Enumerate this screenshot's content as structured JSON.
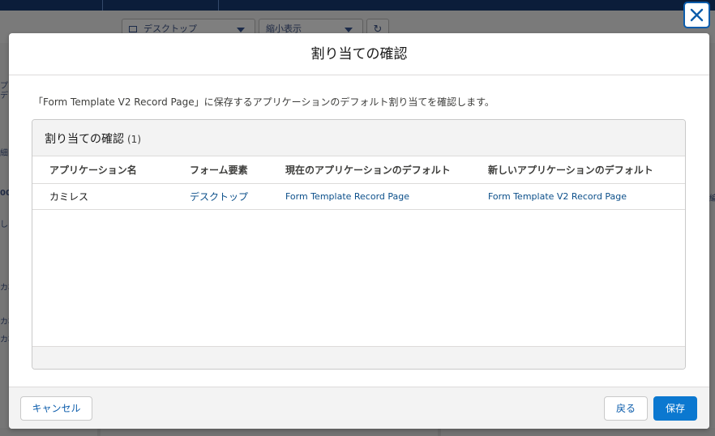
{
  "background": {
    "device_select": "デスクトップ",
    "view_select": "縮小表示",
    "refresh_icon": "refresh-icon",
    "left_fragments": [
      "プ",
      "デ",
      "細",
      "00",
      "しる",
      "カ相",
      "カ相",
      "カ相"
    ],
    "right_fragments": [
      "編"
    ]
  },
  "dialog": {
    "close_icon": "close-icon",
    "title": "割り当ての確認",
    "description": "「Form Template V2 Record Page」に保存するアプリケーションのデフォルト割り当てを確認します。",
    "card": {
      "title": "割り当ての確認",
      "count": "(1)",
      "columns": [
        "アプリケーション名",
        "フォーム要素",
        "現在のアプリケーションのデフォルト",
        "新しいアプリケーションのデフォルト"
      ],
      "rows": [
        [
          "カミレス",
          "デスクトップ",
          "Form Template Record Page",
          "Form Template V2 Record Page"
        ]
      ]
    },
    "buttons": {
      "cancel": "キャンセル",
      "back": "戻る",
      "save": "保存"
    }
  },
  "colors": {
    "brand": "#0b78d0",
    "link": "#0b4f8a",
    "header_bar": "#0b1d3a"
  }
}
